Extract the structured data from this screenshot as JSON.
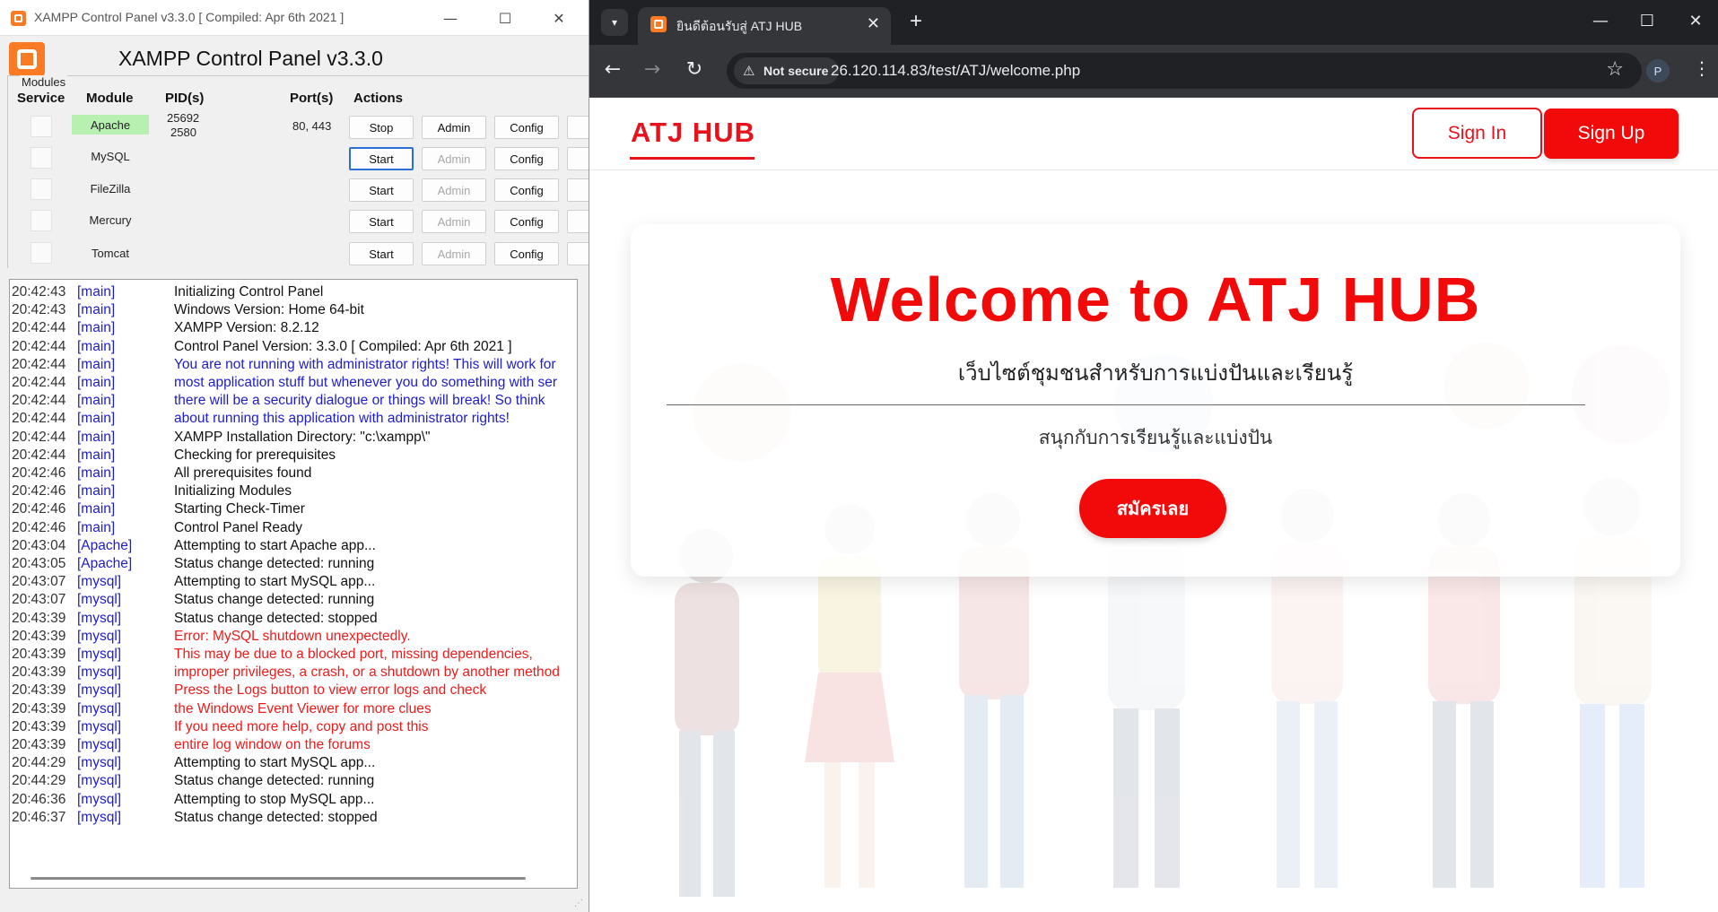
{
  "xampp": {
    "title": "XAMPP Control Panel v3.3.0   [ Compiled: Apr 6th 2021 ]",
    "header_title": "XAMPP Control Panel v3.3.0",
    "modules_label": "Modules",
    "columns": {
      "service": "Service",
      "module": "Module",
      "pids": "PID(s)",
      "ports": "Port(s)",
      "actions": "Actions"
    },
    "modules": [
      {
        "name": "Apache",
        "pid1": "25692",
        "pid2": "2580",
        "ports": "80, 443",
        "action": "Stop",
        "admin": "Admin",
        "config": "Config"
      },
      {
        "name": "MySQL",
        "pid1": "",
        "pid2": "",
        "ports": "",
        "action": "Start",
        "admin": "Admin",
        "config": "Config"
      },
      {
        "name": "FileZilla",
        "pid1": "",
        "pid2": "",
        "ports": "",
        "action": "Start",
        "admin": "Admin",
        "config": "Config"
      },
      {
        "name": "Mercury",
        "pid1": "",
        "pid2": "",
        "ports": "",
        "action": "Start",
        "admin": "Admin",
        "config": "Config"
      },
      {
        "name": "Tomcat",
        "pid1": "",
        "pid2": "",
        "ports": "",
        "action": "Start",
        "admin": "Admin",
        "config": "Config"
      }
    ],
    "log_colors": {
      "normal": "#111111",
      "info": "#1d1dcc",
      "error": "#f01a1a"
    },
    "log": [
      {
        "time": "20:42:43",
        "src": "[main]",
        "msg": "Initializing Control Panel",
        "kind": "normal"
      },
      {
        "time": "20:42:43",
        "src": "[main]",
        "msg": "Windows Version:  Home  64-bit",
        "kind": "normal"
      },
      {
        "time": "20:42:44",
        "src": "[main]",
        "msg": "XAMPP Version: 8.2.12",
        "kind": "normal"
      },
      {
        "time": "20:42:44",
        "src": "[main]",
        "msg": "Control Panel Version: 3.3.0  [ Compiled: Apr 6th 2021 ]",
        "kind": "normal"
      },
      {
        "time": "20:42:44",
        "src": "[main]",
        "msg": "You are not running with administrator rights! This will work for",
        "kind": "info"
      },
      {
        "time": "20:42:44",
        "src": "[main]",
        "msg": "most application stuff but whenever you do something with ser",
        "kind": "info"
      },
      {
        "time": "20:42:44",
        "src": "[main]",
        "msg": "there will be a security dialogue or things will break! So think",
        "kind": "info"
      },
      {
        "time": "20:42:44",
        "src": "[main]",
        "msg": "about running this application with administrator rights!",
        "kind": "info"
      },
      {
        "time": "20:42:44",
        "src": "[main]",
        "msg": "XAMPP Installation Directory: \"c:\\xampp\\\"",
        "kind": "normal"
      },
      {
        "time": "20:42:44",
        "src": "[main]",
        "msg": "Checking for prerequisites",
        "kind": "normal"
      },
      {
        "time": "20:42:46",
        "src": "[main]",
        "msg": "All prerequisites found",
        "kind": "normal"
      },
      {
        "time": "20:42:46",
        "src": "[main]",
        "msg": "Initializing Modules",
        "kind": "normal"
      },
      {
        "time": "20:42:46",
        "src": "[main]",
        "msg": "Starting Check-Timer",
        "kind": "normal"
      },
      {
        "time": "20:42:46",
        "src": "[main]",
        "msg": "Control Panel Ready",
        "kind": "normal"
      },
      {
        "time": "20:43:04",
        "src": "[Apache]",
        "msg": "Attempting to start Apache app...",
        "kind": "normal"
      },
      {
        "time": "20:43:05",
        "src": "[Apache]",
        "msg": "Status change detected: running",
        "kind": "normal"
      },
      {
        "time": "20:43:07",
        "src": "[mysql]",
        "msg": "Attempting to start MySQL app...",
        "kind": "normal"
      },
      {
        "time": "20:43:07",
        "src": "[mysql]",
        "msg": "Status change detected: running",
        "kind": "normal"
      },
      {
        "time": "20:43:39",
        "src": "[mysql]",
        "msg": "Status change detected: stopped",
        "kind": "normal"
      },
      {
        "time": "20:43:39",
        "src": "[mysql]",
        "msg": "Error: MySQL shutdown unexpectedly.",
        "kind": "error"
      },
      {
        "time": "20:43:39",
        "src": "[mysql]",
        "msg": "This may be due to a blocked port, missing dependencies,",
        "kind": "error"
      },
      {
        "time": "20:43:39",
        "src": "[mysql]",
        "msg": "improper privileges, a crash, or a shutdown by another method",
        "kind": "error"
      },
      {
        "time": "20:43:39",
        "src": "[mysql]",
        "msg": "Press the Logs button to view error logs and check",
        "kind": "error"
      },
      {
        "time": "20:43:39",
        "src": "[mysql]",
        "msg": "the Windows Event Viewer for more clues",
        "kind": "error"
      },
      {
        "time": "20:43:39",
        "src": "[mysql]",
        "msg": "If you need more help, copy and post this",
        "kind": "error"
      },
      {
        "time": "20:43:39",
        "src": "[mysql]",
        "msg": "entire log window on the forums",
        "kind": "error"
      },
      {
        "time": "20:44:29",
        "src": "[mysql]",
        "msg": "Attempting to start MySQL app...",
        "kind": "normal"
      },
      {
        "time": "20:44:29",
        "src": "[mysql]",
        "msg": "Status change detected: running",
        "kind": "normal"
      },
      {
        "time": "20:46:36",
        "src": "[mysql]",
        "msg": "Attempting to stop MySQL app...",
        "kind": "normal"
      },
      {
        "time": "20:46:37",
        "src": "[mysql]",
        "msg": "Status change detected: stopped",
        "kind": "normal"
      }
    ]
  },
  "browser": {
    "tab_title": "ยินดีต้อนรับสู่ ATJ HUB",
    "security_label": "Not secure",
    "url": "26.120.114.83/test/ATJ/welcome.php",
    "profile_initial": "P"
  },
  "site": {
    "brand": "ATJ HUB",
    "sign_in": "Sign In",
    "sign_up": "Sign Up",
    "hero_title": "Welcome to ATJ HUB",
    "hero_subtitle": "เว็บไซต์ชุมชนสำหรับการแบ่งปันและเรียนรู้",
    "hero_tagline": "สนุกกับการเรียนรู้และแบ่งปัน",
    "cta": "สมัครเลย",
    "accent_color": "#f20a0a"
  }
}
